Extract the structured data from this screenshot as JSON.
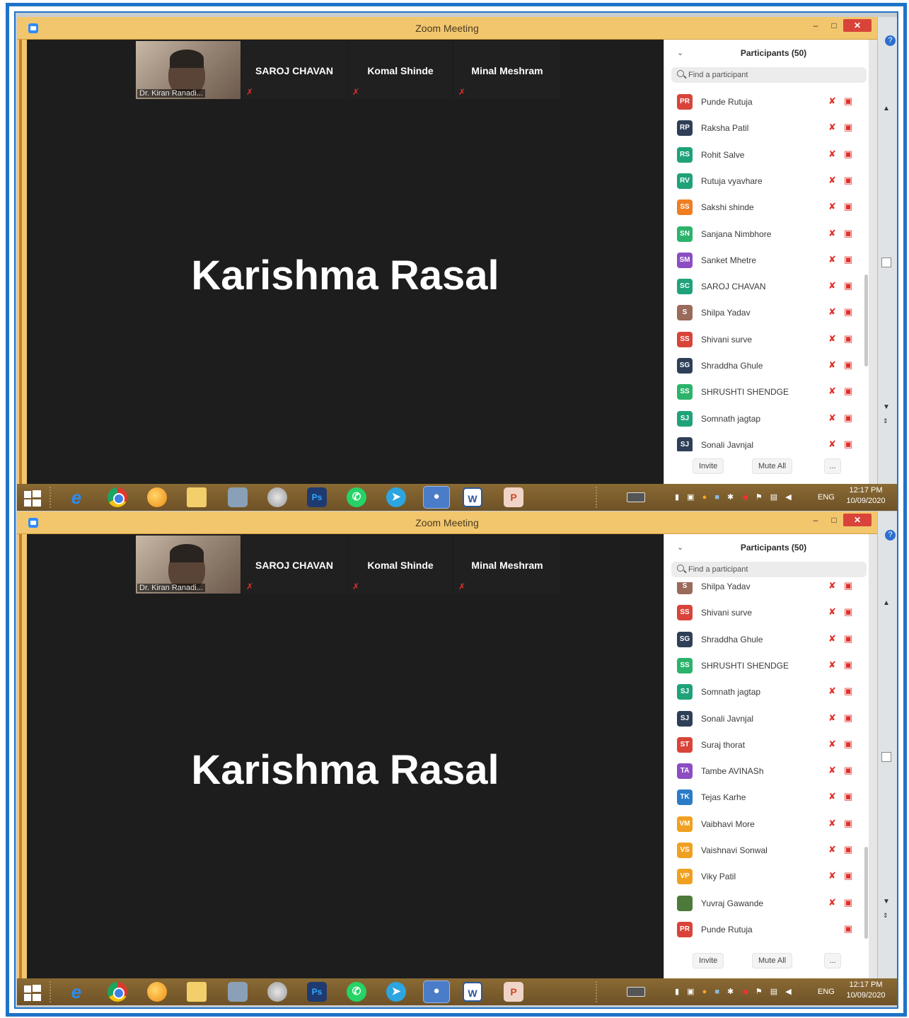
{
  "screens": [
    {
      "window_title": "Zoom Meeting",
      "thumbnails": [
        {
          "name": "Dr. Kiran Ranadi..."
        },
        {
          "name": "SAROJ CHAVAN"
        },
        {
          "name": "Komal Shinde"
        },
        {
          "name": "Minal Meshram"
        }
      ],
      "speaker": "Karishma Rasal",
      "panel_title": "Participants (50)",
      "search_placeholder": "Find a participant",
      "participants": [
        {
          "initials": "PR",
          "name": "Punde Rutuja",
          "color": "#d9443a"
        },
        {
          "initials": "RP",
          "name": "Raksha Patil",
          "color": "#2f3f57"
        },
        {
          "initials": "RS",
          "name": "Rohit Salve",
          "color": "#1fa27a"
        },
        {
          "initials": "RV",
          "name": "Rutuja vyavhare",
          "color": "#1fa27a"
        },
        {
          "initials": "SS",
          "name": "Sakshi shinde",
          "color": "#ef7d21"
        },
        {
          "initials": "SN",
          "name": "Sanjana Nimbhore",
          "color": "#2bb36b"
        },
        {
          "initials": "SM",
          "name": "Sanket Mhetre",
          "color": "#8c4cc2"
        },
        {
          "initials": "SC",
          "name": "SAROJ CHAVAN",
          "color": "#1fa27a"
        },
        {
          "initials": "S",
          "name": "Shilpa Yadav",
          "color": "#9a6a5a"
        },
        {
          "initials": "SS",
          "name": "Shivani surve",
          "color": "#d9443a"
        },
        {
          "initials": "SG",
          "name": "Shraddha Ghule",
          "color": "#2f3f57"
        },
        {
          "initials": "SS",
          "name": "SHRUSHTI SHENDGE",
          "color": "#2bb36b"
        },
        {
          "initials": "SJ",
          "name": "Somnath jagtap",
          "color": "#1fa27a"
        },
        {
          "initials": "SJ",
          "name": "Sonali Javnjal",
          "color": "#2f3f57"
        }
      ],
      "footer": {
        "invite": "Invite",
        "mute_all": "Mute All",
        "more": "..."
      },
      "taskbar": {
        "lang": "ENG",
        "time": "12:17 PM",
        "date": "10/09/2020"
      }
    },
    {
      "window_title": "Zoom Meeting",
      "thumbnails": [
        {
          "name": "Dr. Kiran Ranadi..."
        },
        {
          "name": "SAROJ CHAVAN"
        },
        {
          "name": "Komal Shinde"
        },
        {
          "name": "Minal Meshram"
        }
      ],
      "speaker": "Karishma Rasal",
      "panel_title": "Participants (50)",
      "search_placeholder": "Find a participant",
      "participants": [
        {
          "initials": "S",
          "name": "Shilpa Yadav",
          "color": "#9a6a5a"
        },
        {
          "initials": "SS",
          "name": "Shivani surve",
          "color": "#d9443a"
        },
        {
          "initials": "SG",
          "name": "Shraddha Ghule",
          "color": "#2f3f57"
        },
        {
          "initials": "SS",
          "name": "SHRUSHTI SHENDGE",
          "color": "#2bb36b"
        },
        {
          "initials": "SJ",
          "name": "Somnath jagtap",
          "color": "#1fa27a"
        },
        {
          "initials": "SJ",
          "name": "Sonali Javnjal",
          "color": "#2f3f57"
        },
        {
          "initials": "ST",
          "name": "Suraj thorat",
          "color": "#d9443a"
        },
        {
          "initials": "TA",
          "name": "Tambe AVINASh",
          "color": "#8c4cc2"
        },
        {
          "initials": "TK",
          "name": "Tejas Karhe",
          "color": "#2a7cc7"
        },
        {
          "initials": "VM",
          "name": "Vaibhavi More",
          "color": "#f0a020"
        },
        {
          "initials": "VS",
          "name": "Vaishnavi Sonwal",
          "color": "#f0a020"
        },
        {
          "initials": "VP",
          "name": "Viky Patil",
          "color": "#f0a020"
        },
        {
          "initials": "",
          "name": "Yuvraj Gawande",
          "color": "#4d7a3a"
        },
        {
          "initials": "PR",
          "name": "Punde Rutuja",
          "color": "#d9443a"
        }
      ],
      "footer": {
        "invite": "Invite",
        "mute_all": "Mute All",
        "more": "..."
      },
      "taskbar": {
        "lang": "ENG",
        "time": "12:17 PM",
        "date": "10/09/2020"
      }
    }
  ]
}
